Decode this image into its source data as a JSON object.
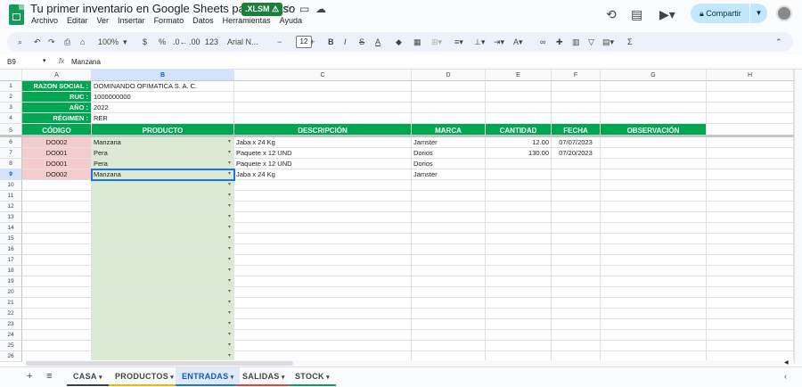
{
  "title": "Tu primer inventario en Google Sheets paso a paso",
  "badge": ".XLSM ⚠",
  "menus": [
    "Archivo",
    "Editar",
    "Ver",
    "Insertar",
    "Formato",
    "Datos",
    "Herramientas",
    "Ayuda"
  ],
  "share": "Compartir",
  "toolbar": {
    "zoom": "100%",
    "currency": "$",
    "percent": "%",
    "dec_less": ".0←",
    "dec_more": ".00",
    "numfmt": "123",
    "font": "Arial N...",
    "fontsize": "12"
  },
  "formula": {
    "cellref": "B9",
    "fx": "fx",
    "value": "Manzana"
  },
  "columns": [
    "A",
    "B",
    "C",
    "D",
    "E",
    "F",
    "G",
    "H"
  ],
  "info": [
    {
      "label": "RAZON SOCIAL :",
      "value": "DOMINANDO OFIMATICA S. A. C."
    },
    {
      "label": "RUC :",
      "value": "1000000000"
    },
    {
      "label": "AÑO :",
      "value": "2022"
    },
    {
      "label": "RÉGIMEN :",
      "value": "RER"
    }
  ],
  "headers": [
    "CÓDIGO",
    "PRODUCTO",
    "DESCRIPCIÓN",
    "MARCA",
    "CANTIDAD",
    "FECHA",
    "OBSERVACIÓN"
  ],
  "rows": [
    {
      "codigo": "DO002",
      "producto": "Manzana",
      "descripcion": "Jaba x 24 Kg",
      "marca": "Jamster",
      "cantidad": "12.00",
      "fecha": "07/07/2023"
    },
    {
      "codigo": "DO001",
      "producto": "Pera",
      "descripcion": "Paquete x 12 UND",
      "marca": "Dorios",
      "cantidad": "130.00",
      "fecha": "07/20/2023"
    },
    {
      "codigo": "DO001",
      "producto": "Pera",
      "descripcion": "Paquete x 12 UND",
      "marca": "Dorios",
      "cantidad": "",
      "fecha": ""
    },
    {
      "codigo": "DO002",
      "producto": "Manzana",
      "descripcion": "Jaba x 24 Kg",
      "marca": "Jamster",
      "cantidad": "",
      "fecha": ""
    }
  ],
  "row_numbers": [
    "1",
    "2",
    "3",
    "4",
    "5",
    "6",
    "7",
    "8",
    "9",
    "10",
    "11",
    "12",
    "13",
    "14",
    "15",
    "16",
    "17",
    "18",
    "19",
    "20",
    "21",
    "22",
    "23",
    "24",
    "25",
    "26"
  ],
  "tabs": [
    {
      "name": "CASA",
      "color": "#3c4043"
    },
    {
      "name": "PRODUCTOS",
      "color": "#f4b400"
    },
    {
      "name": "ENTRADAS",
      "color": "#1a73e8"
    },
    {
      "name": "SALIDAS",
      "color": "#ea4335"
    },
    {
      "name": "STOCK",
      "color": "#0f9d58"
    }
  ],
  "active_tab": "ENTRADAS",
  "selected_cell": "B9"
}
